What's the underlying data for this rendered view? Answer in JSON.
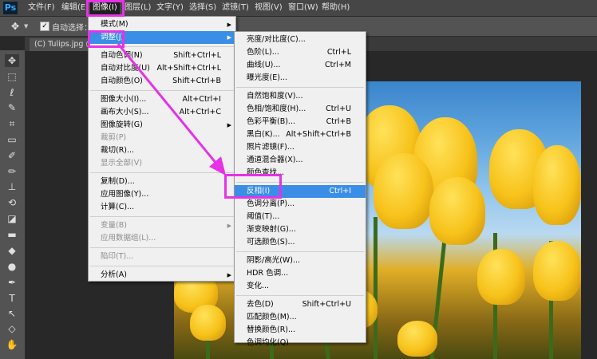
{
  "app": {
    "logo": "Ps"
  },
  "menubar": [
    {
      "label": "文件(F)"
    },
    {
      "label": "编辑(E)"
    },
    {
      "label": "图像(I)",
      "active": true
    },
    {
      "label": "图层(L)"
    },
    {
      "label": "文字(Y)"
    },
    {
      "label": "选择(S)"
    },
    {
      "label": "滤镜(T)"
    },
    {
      "label": "视图(V)"
    },
    {
      "label": "窗口(W)"
    },
    {
      "label": "帮助(H)"
    }
  ],
  "options_bar": {
    "move_icon": "move-icon",
    "auto_select_label": "自动选择："
  },
  "document": {
    "tab_label": "(C) Tulips.jpg @ 6"
  },
  "tools": [
    "move-tool-icon",
    "marquee-tool-icon",
    "lasso-tool-icon",
    "quick-select-icon",
    "crop-tool-icon",
    "eyedropper-icon",
    "healing-brush-icon",
    "brush-tool-icon",
    "stamp-tool-icon",
    "history-brush-icon",
    "eraser-tool-icon",
    "gradient-tool-icon",
    "blur-tool-icon",
    "dodge-tool-icon",
    "pen-tool-icon",
    "type-tool-icon",
    "path-select-icon",
    "shape-tool-icon",
    "hand-tool-icon"
  ],
  "image_menu": {
    "items": [
      {
        "label": "模式(M)",
        "shortcut": "",
        "submenu": true,
        "enabled": true
      },
      {
        "label": "调整(J)",
        "shortcut": "",
        "submenu": true,
        "enabled": true,
        "highlighted": true
      },
      {
        "separator": true
      },
      {
        "label": "自动色调(N)",
        "shortcut": "Shift+Ctrl+L",
        "enabled": true
      },
      {
        "label": "自动对比度(U)",
        "shortcut": "Alt+Shift+Ctrl+L",
        "enabled": true
      },
      {
        "label": "自动颜色(O)",
        "shortcut": "Shift+Ctrl+B",
        "enabled": true
      },
      {
        "separator": true
      },
      {
        "label": "图像大小(I)...",
        "shortcut": "Alt+Ctrl+I",
        "enabled": true
      },
      {
        "label": "画布大小(S)...",
        "shortcut": "Alt+Ctrl+C",
        "enabled": true
      },
      {
        "label": "图像旋转(G)",
        "shortcut": "",
        "submenu": true,
        "enabled": true
      },
      {
        "label": "裁剪(P)",
        "shortcut": "",
        "enabled": false
      },
      {
        "label": "裁切(R)...",
        "shortcut": "",
        "enabled": true
      },
      {
        "label": "显示全部(V)",
        "shortcut": "",
        "enabled": false
      },
      {
        "separator": true
      },
      {
        "label": "复制(D)...",
        "shortcut": "",
        "enabled": true
      },
      {
        "label": "应用图像(Y)...",
        "shortcut": "",
        "enabled": true
      },
      {
        "label": "计算(C)...",
        "shortcut": "",
        "enabled": true
      },
      {
        "separator": true
      },
      {
        "label": "变量(B)",
        "shortcut": "",
        "submenu": true,
        "enabled": false
      },
      {
        "label": "应用数据组(L)...",
        "shortcut": "",
        "enabled": false
      },
      {
        "separator": true
      },
      {
        "label": "陷印(T)...",
        "shortcut": "",
        "enabled": false
      },
      {
        "separator": true
      },
      {
        "label": "分析(A)",
        "shortcut": "",
        "submenu": true,
        "enabled": true
      }
    ]
  },
  "adjust_menu": {
    "items": [
      {
        "label": "亮度/对比度(C)...",
        "shortcut": ""
      },
      {
        "label": "色阶(L)...",
        "shortcut": "Ctrl+L"
      },
      {
        "label": "曲线(U)...",
        "shortcut": "Ctrl+M"
      },
      {
        "label": "曝光度(E)...",
        "shortcut": ""
      },
      {
        "separator": true
      },
      {
        "label": "自然饱和度(V)...",
        "shortcut": ""
      },
      {
        "label": "色相/饱和度(H)...",
        "shortcut": "Ctrl+U"
      },
      {
        "label": "色彩平衡(B)...",
        "shortcut": "Ctrl+B"
      },
      {
        "label": "黑白(K)...",
        "shortcut": "Alt+Shift+Ctrl+B"
      },
      {
        "label": "照片滤镜(F)...",
        "shortcut": ""
      },
      {
        "label": "通道混合器(X)...",
        "shortcut": ""
      },
      {
        "label": "颜色查找...",
        "shortcut": ""
      },
      {
        "separator": true
      },
      {
        "label": "反相(I)",
        "shortcut": "Ctrl+I",
        "highlighted": true
      },
      {
        "label": "色调分离(P)...",
        "shortcut": ""
      },
      {
        "label": "阈值(T)...",
        "shortcut": ""
      },
      {
        "label": "渐变映射(G)...",
        "shortcut": ""
      },
      {
        "label": "可选颜色(S)...",
        "shortcut": ""
      },
      {
        "separator": true
      },
      {
        "label": "阴影/高光(W)...",
        "shortcut": ""
      },
      {
        "label": "HDR 色调...",
        "shortcut": ""
      },
      {
        "label": "变化...",
        "shortcut": ""
      },
      {
        "separator": true
      },
      {
        "label": "去色(D)",
        "shortcut": "Shift+Ctrl+U"
      },
      {
        "label": "匹配颜色(M)...",
        "shortcut": ""
      },
      {
        "label": "替换颜色(R)...",
        "shortcut": ""
      },
      {
        "label": "色调均化(Q)",
        "shortcut": ""
      }
    ]
  },
  "annotation_color": "#e632e6",
  "highlight_color": "#3a8ee6"
}
